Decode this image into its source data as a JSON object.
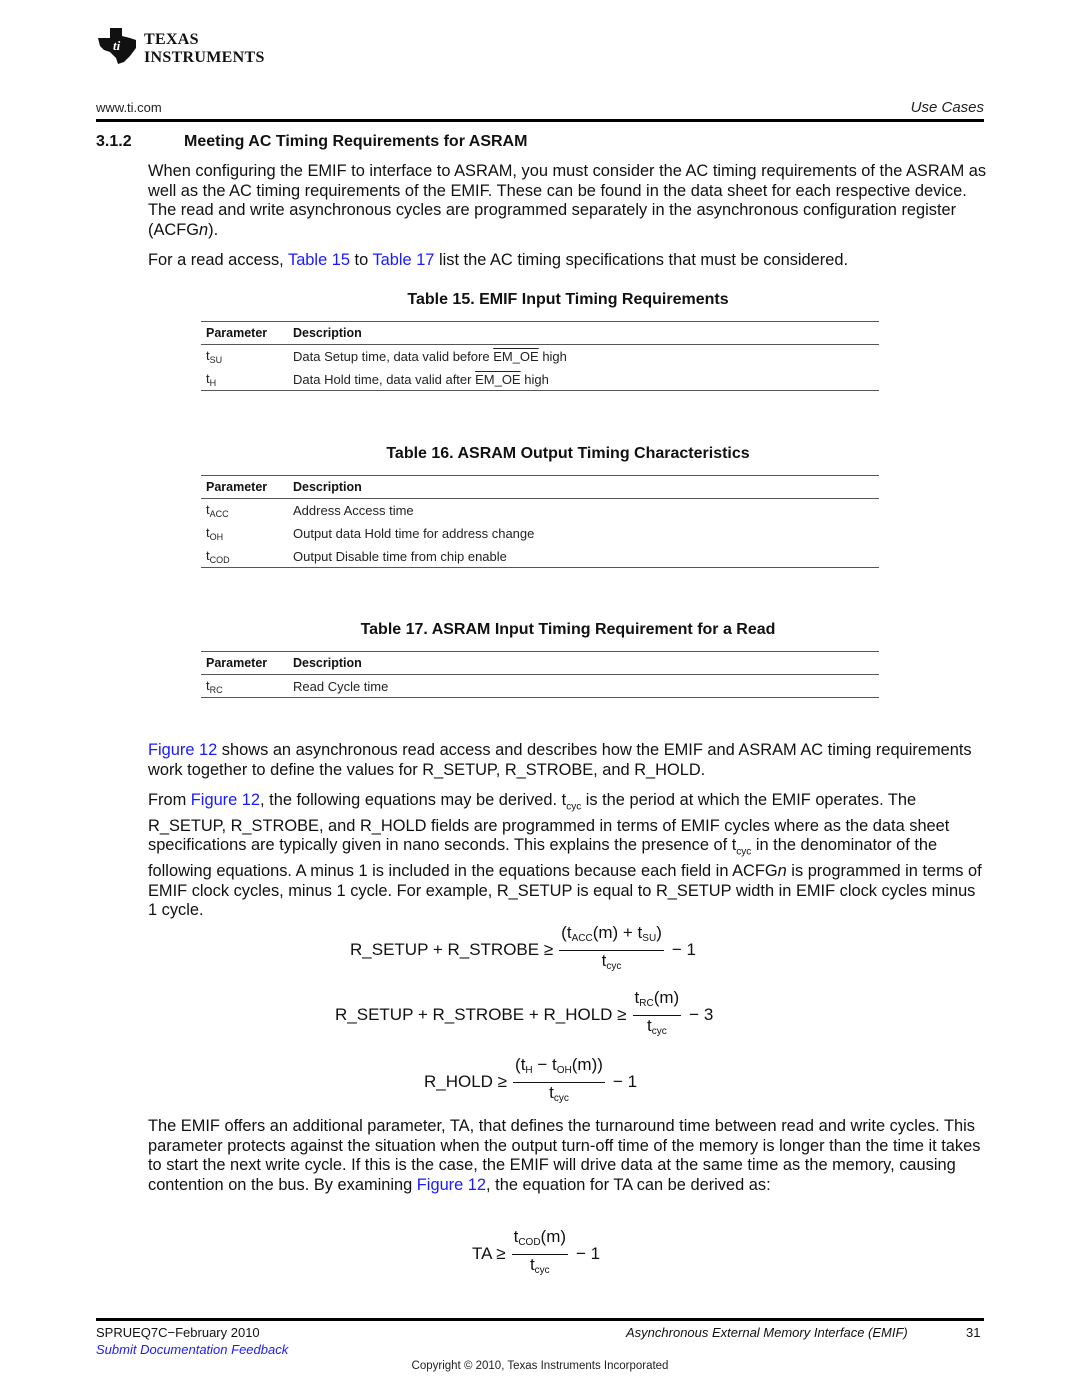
{
  "header": {
    "logo_line1": "Texas",
    "logo_line2": "Instruments",
    "website": "www.ti.com",
    "section_label": "Use Cases"
  },
  "section": {
    "number": "3.1.2",
    "title": "Meeting AC Timing Requirements for ASRAM"
  },
  "intro": {
    "p1": "When configuring the EMIF to interface to ASRAM, you must consider the AC timing requirements of the ASRAM as well as the AC timing requirements of the EMIF. These can be found in the data sheet for each respective device. The read and write asynchronous cycles are programmed separately in the asynchronous configuration register (ACFG",
    "p1_italic": "n",
    "p1_end": ").",
    "p2_a": "For a read access, ",
    "p2_link1": "Table 15",
    "p2_b": " to ",
    "p2_link2": "Table 17",
    "p2_c": " list the AC timing specifications that must be considered."
  },
  "tables": [
    {
      "title": "Table 15. EMIF Input Timing Requirements",
      "headers": [
        "Parameter",
        "Description"
      ],
      "rows": [
        {
          "param": "t",
          "sub": "SU",
          "desc_a": "Data Setup time, data valid before ",
          "desc_ovl": "EM_OE",
          "desc_b": " high"
        },
        {
          "param": "t",
          "sub": "H",
          "desc_a": "Data Hold time, data valid after ",
          "desc_ovl": "EM_OE",
          "desc_b": " high"
        }
      ]
    },
    {
      "title": "Table 16. ASRAM Output Timing Characteristics",
      "headers": [
        "Parameter",
        "Description"
      ],
      "rows": [
        {
          "param": "t",
          "sub": "ACC",
          "desc_a": "Address Access time"
        },
        {
          "param": "t",
          "sub": "OH",
          "desc_a": "Output data Hold time for address change"
        },
        {
          "param": "t",
          "sub": "COD",
          "desc_a": "Output Disable time from chip enable"
        }
      ]
    },
    {
      "title": "Table 17. ASRAM Input Timing Requirement for a Read",
      "headers": [
        "Parameter",
        "Description"
      ],
      "rows": [
        {
          "param": "t",
          "sub": "RC",
          "desc_a": "Read Cycle time"
        }
      ]
    }
  ],
  "body": {
    "p3_link": "Figure 12",
    "p3_rest": " shows an asynchronous read access and describes how the EMIF and ASRAM AC timing requirements work together to define the values for R_SETUP, R_STROBE, and R_HOLD.",
    "p4_a": "From ",
    "p4_link": "Figure 12",
    "p4_b": ", the following equations may be derived. t",
    "p4_sub1": "cyc",
    "p4_c": " is the period at which the EMIF operates. The R_SETUP, R_STROBE, and R_HOLD fields are programmed in terms of EMIF cycles where as the data sheet specifications are typically given in nano seconds. This explains the presence of t",
    "p4_sub2": "cyc",
    "p4_d": " in the denominator of the following equations. A minus 1 is included in the equations because each field in ACFG",
    "p4_italic": "n",
    "p4_e": " is programmed in terms of EMIF clock cycles, minus 1 cycle. For example, R_SETUP is equal to R_SETUP width in EMIF clock cycles minus 1 cycle.",
    "p5_a": "The EMIF offers an additional parameter, TA, that defines the turnaround time between read and write cycles. This parameter protects against the situation when the output turn-off time of the memory is longer than the time it takes to start the next write cycle. If this is the case, the EMIF will drive data at the same time as the memory, causing contention on the bus. By examining ",
    "p5_link": "Figure 12",
    "p5_b": ", the equation for TA can be derived as:"
  },
  "equations": {
    "eq1": {
      "lhs": "R_SETUP + R_STROBE ≥",
      "num_a": "(t",
      "num_sub1": "ACC",
      "num_b": "(m) + t",
      "num_sub2": "SU",
      "num_c": ")",
      "den": "t",
      "den_sub": "cyc",
      "tail": "− 1"
    },
    "eq2": {
      "lhs": "R_SETUP + R_STROBE + R_HOLD ≥",
      "num_a": "t",
      "num_sub1": "RC",
      "num_b": "(m)",
      "den": "t",
      "den_sub": "cyc",
      "tail": "− 3"
    },
    "eq3": {
      "lhs": "R_HOLD ≥",
      "num_a": "(t",
      "num_sub1": "H",
      "num_b": " − t",
      "num_sub2": "OH",
      "num_c": "(m))",
      "den": "t",
      "den_sub": "cyc",
      "tail": "− 1"
    },
    "eq4": {
      "lhs": "TA ≥",
      "num_a": "t",
      "num_sub1": "COD",
      "num_b": "(m)",
      "den": "t",
      "den_sub": "cyc",
      "tail": "− 1"
    }
  },
  "footer": {
    "doc_id": "SPRUEQ7C−February 2010",
    "doc_title": "Asynchronous External Memory Interface (EMIF)",
    "page": "31",
    "feedback": "Submit Documentation Feedback",
    "copyright": "Copyright © 2010, Texas Instruments Incorporated"
  },
  "colors": {
    "link": "#1a1aff",
    "text": "#111111"
  }
}
